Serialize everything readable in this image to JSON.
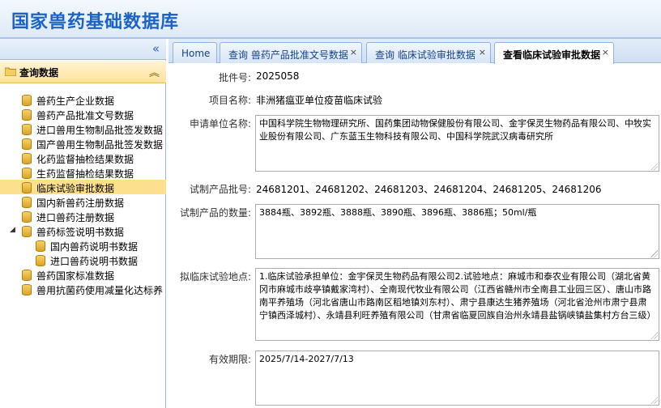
{
  "app": {
    "title": "国家兽药基础数据库"
  },
  "sidebar": {
    "collapse_icon": "double-chevron-left",
    "section_title": "查询数据",
    "items": [
      {
        "label": "兽药生产企业数据"
      },
      {
        "label": "兽药产品批准文号数据"
      },
      {
        "label": "进口兽用生物制品批签发数据"
      },
      {
        "label": "国产兽用生物制品批签发数据"
      },
      {
        "label": "化药监督抽检结果数据"
      },
      {
        "label": "生药监督抽检结果数据"
      },
      {
        "label": "临床试验审批数据",
        "selected": true
      },
      {
        "label": "国内新兽药注册数据"
      },
      {
        "label": "进口兽药注册数据"
      },
      {
        "label": "兽药标签说明书数据",
        "expanded": true
      },
      {
        "label": "国内兽药说明书数据"
      },
      {
        "label": "进口兽药说明书数据"
      },
      {
        "label": "兽药国家标准数据"
      },
      {
        "label": "兽用抗菌药使用减量化达标养"
      }
    ]
  },
  "tabs": [
    {
      "label": "Home",
      "closable": false
    },
    {
      "label": "查询 兽药产品批准文号数据",
      "closable": true
    },
    {
      "label": "查询 临床试验审批数据",
      "closable": true
    },
    {
      "label": "查看临床试验审批数据",
      "closable": true,
      "active": true
    }
  ],
  "tab_close_glyph": "×",
  "form": {
    "approval_no": {
      "label": "批件号:",
      "value": "2025058"
    },
    "project_name": {
      "label": "项目名称:",
      "value": "非洲猪瘟亚单位疫苗临床试验"
    },
    "applicant": {
      "label": "申请单位名称:",
      "value": "中国科学院生物物理研究所、国药集团动物保健股份有限公司、金宇保灵生物药品有限公司、中牧实业股份有限公司、广东蓝玉生物科技有限公司、中国科学院武汉病毒研究所"
    },
    "batch_no": {
      "label": "试制产品批号:",
      "value": "24681201、24681202、24681203、24681204、24681205、24681206"
    },
    "quantity": {
      "label": "试制产品的数量:",
      "value": "3884瓶、3892瓶、3888瓶、3890瓶、3896瓶、3886瓶；50ml/瓶"
    },
    "location": {
      "label": "拟临床试验地点:",
      "value": "1.临床试验承担单位：金宇保灵生物药品有限公司2.试验地点：麻城市和泰农业有限公司（湖北省黄冈市麻城市歧亭镇戴家湾村）、全南现代牧业有限公司（江西省赣州市全南县工业园三区）、唐山市路南平养殖场（河北省唐山市路南区稻地镇刘东村）、肃宁县康达生猪养殖场（河北省沧州市肃宁县肃宁镇西泽城村）、永靖县利旺养殖有限公司（甘肃省临夏回族自治州永靖县盐锅峡镇盐集村方台三级）"
    },
    "validity": {
      "label": "有效期限:",
      "value": "2025/7/14-2027/7/13"
    }
  }
}
